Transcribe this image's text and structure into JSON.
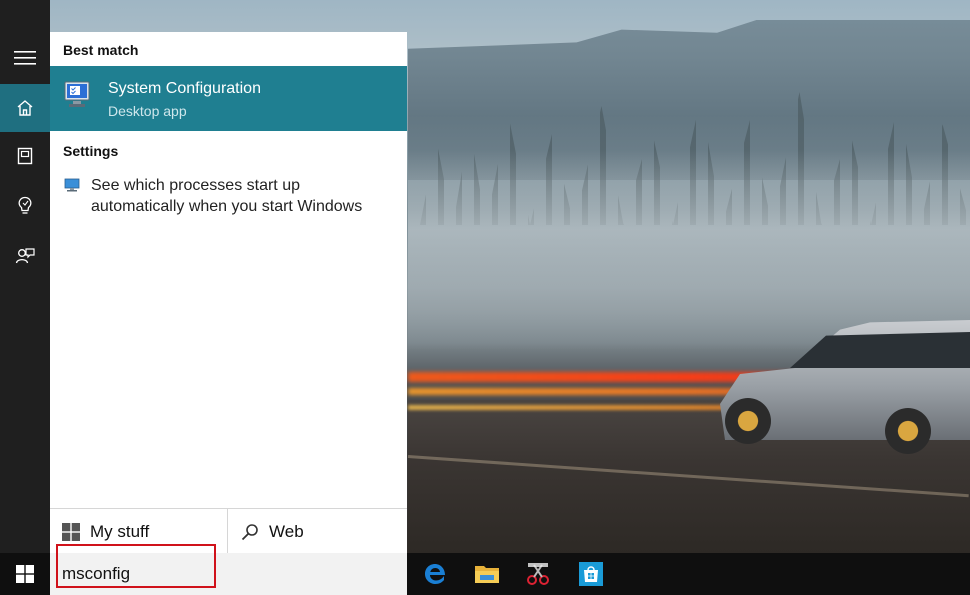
{
  "sidebar": {
    "items": [
      {
        "icon": "hamburger-menu-icon"
      },
      {
        "icon": "home-icon",
        "active": true
      },
      {
        "icon": "notebook-icon"
      },
      {
        "icon": "lightbulb-icon"
      },
      {
        "icon": "feedback-icon"
      }
    ]
  },
  "results": {
    "best_match_label": "Best match",
    "best_match": {
      "title": "System Configuration",
      "subtitle": "Desktop app",
      "icon": "system-configuration-icon"
    },
    "settings_label": "Settings",
    "settings_items": [
      {
        "text": "See which processes start up automatically when you start Windows",
        "icon": "monitor-settings-icon"
      }
    ]
  },
  "bottom_tabs": {
    "my_stuff": "My stuff",
    "web": "Web"
  },
  "search": {
    "value": "msconfig"
  },
  "taskbar": {
    "apps": [
      {
        "name": "edge-icon"
      },
      {
        "name": "file-explorer-icon"
      },
      {
        "name": "snipping-tool-icon"
      },
      {
        "name": "store-icon"
      }
    ]
  },
  "colors": {
    "accent": "#1f7f91",
    "highlight": "#d0121b"
  }
}
